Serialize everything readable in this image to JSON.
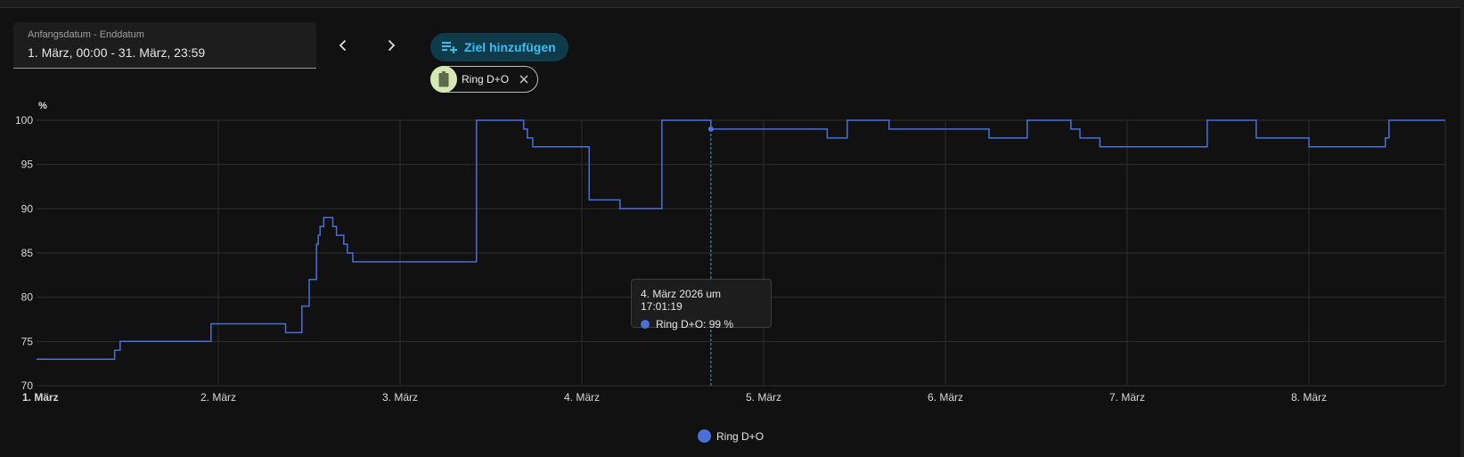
{
  "date_range": {
    "label": "Anfangsdatum - Enddatum",
    "value": "1. März, 00:00 - 31. März, 23:59"
  },
  "add_target": {
    "label": "Ziel hinzufügen"
  },
  "entity_chip": {
    "label": "Ring D+O",
    "icon": "battery-icon",
    "avatar_color": "#d5e8b4"
  },
  "tooltip": {
    "title": "4. März 2026 um 17:01:19",
    "value_text": "Ring D+O: 99 %"
  },
  "colors": {
    "series": "#4a6fd9",
    "accent": "#39c0f1",
    "background": "#111111"
  },
  "chart_data": {
    "type": "line",
    "step": true,
    "unit": "%",
    "ylim": [
      70,
      100
    ],
    "yticks": [
      70,
      75,
      80,
      85,
      90,
      95,
      100
    ],
    "xlim": [
      0,
      7.75
    ],
    "xtick_positions": [
      0,
      1,
      2,
      3,
      4,
      5,
      6,
      7
    ],
    "xtick_labels": [
      "1. März",
      "2. März",
      "3. März",
      "4. März",
      "5. März",
      "6. März",
      "7. März",
      "8. März"
    ],
    "grid": true,
    "legend_position": "bottom-center",
    "cursor_x": 3.71,
    "series": [
      {
        "name": "Ring D+O",
        "points": [
          [
            0.0,
            73
          ],
          [
            0.43,
            74
          ],
          [
            0.46,
            75
          ],
          [
            0.96,
            77
          ],
          [
            1.37,
            76
          ],
          [
            1.46,
            79
          ],
          [
            1.5,
            82
          ],
          [
            1.54,
            86
          ],
          [
            1.55,
            87
          ],
          [
            1.56,
            88
          ],
          [
            1.58,
            89
          ],
          [
            1.63,
            88
          ],
          [
            1.65,
            87
          ],
          [
            1.69,
            86
          ],
          [
            1.71,
            85
          ],
          [
            1.74,
            84
          ],
          [
            2.42,
            100
          ],
          [
            2.68,
            99
          ],
          [
            2.7,
            98
          ],
          [
            2.73,
            97
          ],
          [
            3.04,
            91
          ],
          [
            3.21,
            90
          ],
          [
            3.44,
            100
          ],
          [
            3.71,
            99
          ],
          [
            4.35,
            98
          ],
          [
            4.46,
            100
          ],
          [
            4.69,
            99
          ],
          [
            5.24,
            98
          ],
          [
            5.45,
            100
          ],
          [
            5.69,
            99
          ],
          [
            5.74,
            98
          ],
          [
            5.85,
            97
          ],
          [
            6.44,
            100
          ],
          [
            6.71,
            98
          ],
          [
            7.0,
            97
          ],
          [
            7.42,
            98
          ],
          [
            7.44,
            100
          ],
          [
            7.75,
            100
          ]
        ]
      }
    ]
  }
}
